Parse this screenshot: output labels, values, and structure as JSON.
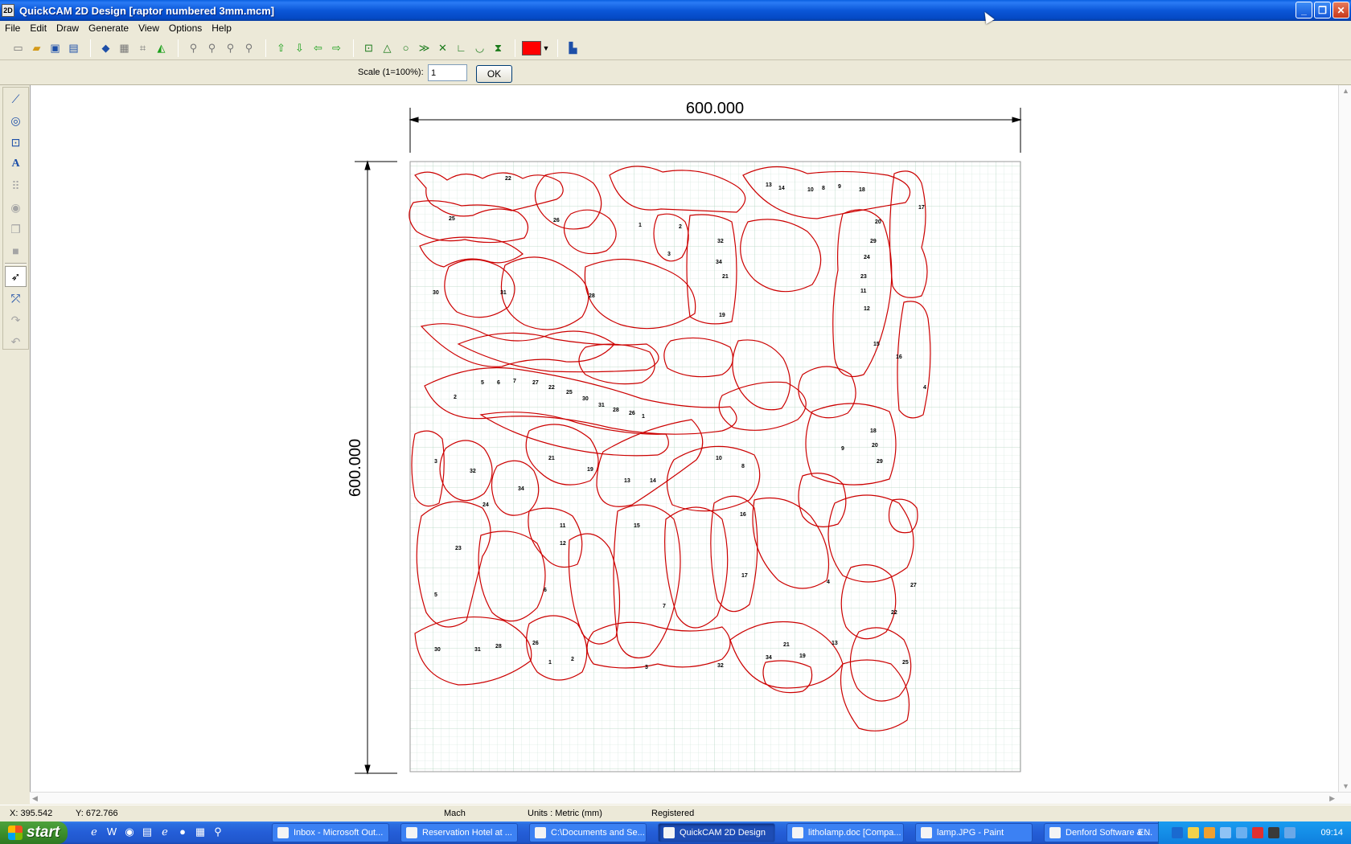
{
  "window": {
    "title": "QuickCAM 2D Design [raptor numbered 3mm.mcm]",
    "app_icon_text": "2D"
  },
  "menu": [
    "File",
    "Edit",
    "Draw",
    "Generate",
    "View",
    "Options",
    "Help"
  ],
  "toolbar": {
    "groups": [
      [
        "new-file",
        "open-file",
        "save-file",
        "save-all"
      ],
      [
        "layers",
        "grid",
        "snap",
        "measure"
      ],
      [
        "zoom-in",
        "zoom-window",
        "zoom-out",
        "zoom-previous"
      ],
      [
        "arrow-up",
        "arrow-down",
        "arrow-left",
        "arrow-right"
      ],
      [
        "box",
        "triangle",
        "circle",
        "double-arrow",
        "cross",
        "corner",
        "arc",
        "hourglass"
      ]
    ],
    "current_color": "#ff0000"
  },
  "scale": {
    "label": "Scale (1=100%):",
    "value": "1",
    "ok_label": "OK"
  },
  "palette": [
    "line-tool",
    "circle-tool",
    "rectangle-tool",
    "text-tool",
    "array-tool",
    "offset-tool",
    "copy-tool",
    "fill-tool",
    "select-tool",
    "node-edit-tool",
    "redo-tool",
    "undo-tool"
  ],
  "drawing": {
    "width_dimension": "600.000",
    "height_dimension": "600.000",
    "stroke_color": "#cc0000",
    "labels": [
      "22",
      "25",
      "30",
      "31",
      "28",
      "26",
      "1",
      "2",
      "3",
      "32",
      "34",
      "21",
      "19",
      "13",
      "14",
      "10",
      "8",
      "9",
      "18",
      "20",
      "29",
      "24",
      "23",
      "11",
      "12",
      "15",
      "16",
      "17",
      "4",
      "5",
      "6",
      "7",
      "27"
    ]
  },
  "status": {
    "x": "X: 395.542",
    "y": "Y: 672.766",
    "mode": "Mach",
    "units": "Units : Metric (mm)",
    "reg": "Registered"
  },
  "taskbar": {
    "start": "start",
    "tasks": [
      {
        "label": "Inbox - Microsoft Out...",
        "active": false
      },
      {
        "label": "Reservation Hotel at ...",
        "active": false
      },
      {
        "label": "C:\\Documents and Se...",
        "active": false
      },
      {
        "label": "QuickCAM 2D Design",
        "active": true
      },
      {
        "label": "litholamp.doc [Compa...",
        "active": false
      },
      {
        "label": "lamp.JPG - Paint",
        "active": false
      },
      {
        "label": "Denford Software & ...",
        "active": false
      }
    ],
    "lang": "EN",
    "clock": "09:14"
  }
}
